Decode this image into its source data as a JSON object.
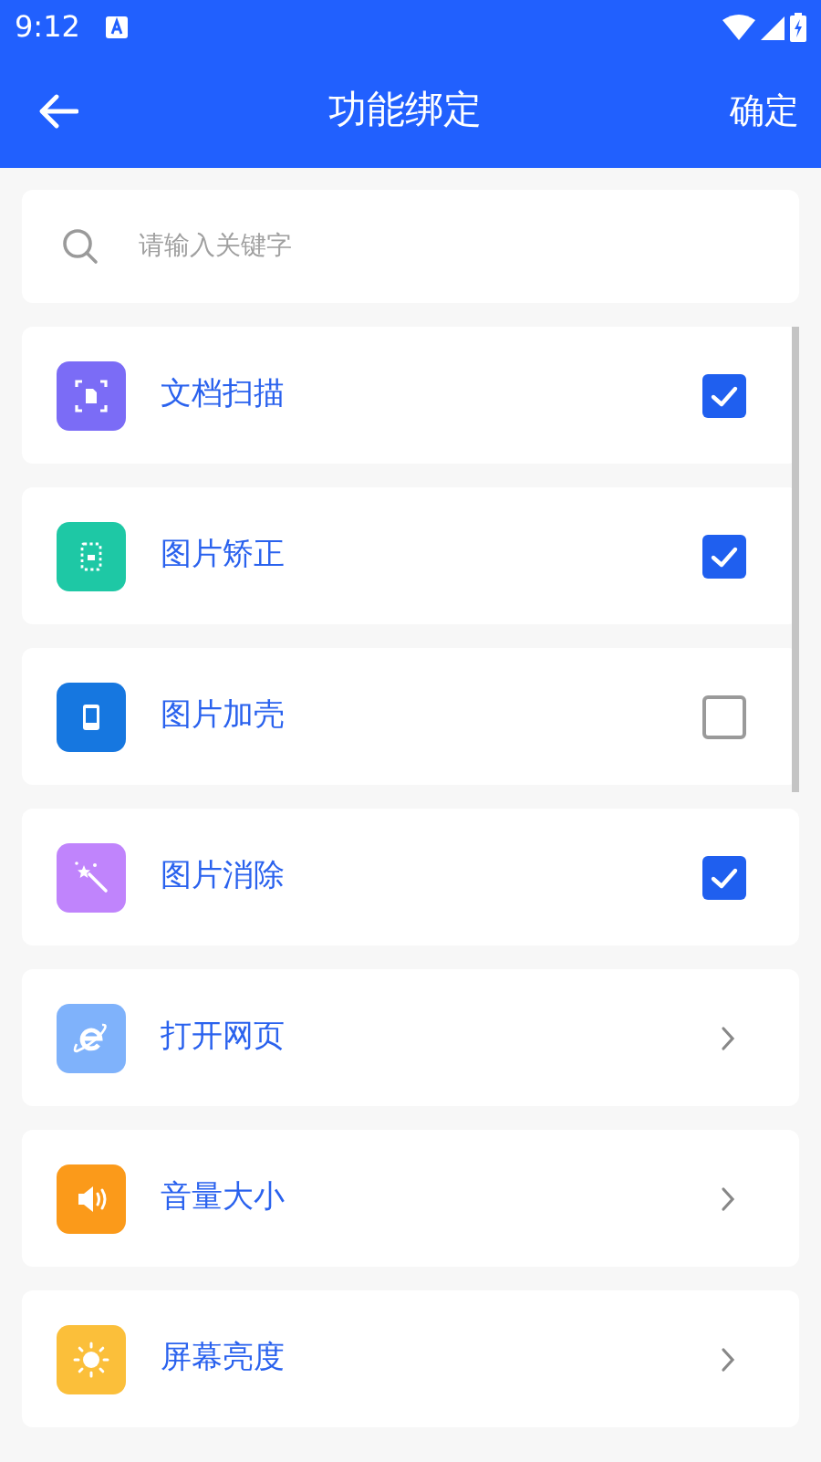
{
  "status_bar": {
    "time": "9:12"
  },
  "header": {
    "title": "功能绑定",
    "action": "确定"
  },
  "search": {
    "placeholder": "请输入关键字"
  },
  "items": [
    {
      "label": "文档扫描",
      "kind": "checkbox",
      "checked": true,
      "color": "#7b6cf6"
    },
    {
      "label": "图片矫正",
      "kind": "checkbox",
      "checked": true,
      "color": "#1ec8a5"
    },
    {
      "label": "图片加壳",
      "kind": "checkbox",
      "checked": false,
      "color": "#1677e0"
    },
    {
      "label": "图片消除",
      "kind": "checkbox",
      "checked": true,
      "color": "#c084fc"
    },
    {
      "label": "打开网页",
      "kind": "link",
      "color": "#7fb2fb"
    },
    {
      "label": "音量大小",
      "kind": "link",
      "color": "#fb9a1a"
    },
    {
      "label": "屏幕亮度",
      "kind": "link",
      "color": "#fbbf3a"
    }
  ]
}
